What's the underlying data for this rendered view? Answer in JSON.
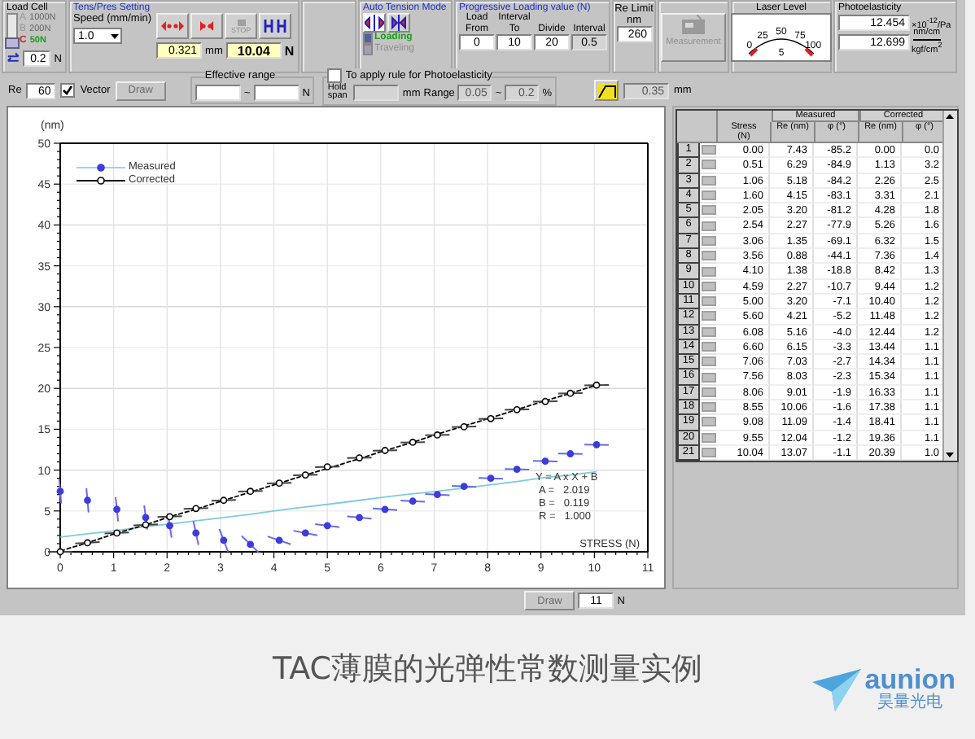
{
  "load_cell": {
    "title": "Load Cell",
    "ranges": [
      {
        "letter": "A",
        "label": "1000N",
        "selected": false
      },
      {
        "letter": "B",
        "label": "200N",
        "selected": false
      },
      {
        "letter": "C",
        "label": "50N",
        "selected": true
      }
    ],
    "value": "0.2",
    "unit": "N"
  },
  "tens_pres": {
    "title": "Tens/Pres Setting",
    "speed_label": "Speed (mm/min)",
    "speed": "1.0",
    "buttons": [
      {
        "kind": "tension",
        "disabled": false
      },
      {
        "kind": "compression",
        "disabled": false
      },
      {
        "kind": "stop",
        "label": "STOP",
        "disabled": true
      },
      {
        "kind": "hold",
        "disabled": false
      }
    ],
    "displacement": "0.321",
    "displacement_unit": "mm",
    "force": "10.04",
    "force_unit": "N"
  },
  "auto_tension": {
    "title": "Auto Tension Mode",
    "modes": [
      {
        "label": "Loading",
        "selected": true
      },
      {
        "label": "Traveling",
        "selected": false
      }
    ]
  },
  "progressive": {
    "title": "Progressive Loading value (N)",
    "fields": [
      {
        "label": "Load From",
        "value": "0",
        "disabled": false
      },
      {
        "label": "Interval To",
        "value": "10",
        "disabled": false
      },
      {
        "label": "Divide",
        "value": "20",
        "disabled": false
      },
      {
        "label": "Interval",
        "value": "0.5",
        "disabled": true
      }
    ]
  },
  "re_limit": {
    "label": "Re Limit",
    "unit": "nm",
    "value": "260"
  },
  "measurement_button": {
    "label": "Measurement",
    "disabled": true
  },
  "laser_level": {
    "title": "Laser Level",
    "ticks": [
      "0",
      "25",
      "50",
      "75",
      "100"
    ],
    "reading": "5"
  },
  "photoelasticity": {
    "title": "Photoelasticity",
    "values": [
      {
        "value": "12.454",
        "unit": "×10$^{-12}$/Pa"
      },
      {
        "value": "12.699",
        "unit_top": "nm/cm",
        "unit_bottom": "kgf/cm$^{2}$"
      }
    ]
  },
  "options": {
    "re_label": "Re",
    "re_value": "60",
    "vector": {
      "label": "Vector",
      "checked": true
    },
    "draw_button": {
      "label": "Draw",
      "disabled": true
    },
    "effective_range": {
      "title": "Effective range",
      "separator": "~",
      "unit": "N"
    },
    "photo_rule": {
      "label": "To apply rule for Photoelasticity",
      "checked": false
    },
    "hold_span": {
      "label": "Hold span",
      "unit": "mm"
    },
    "range": {
      "label": "Range",
      "from": "0.05",
      "separator": "~",
      "to": "0.2",
      "unit": "%"
    },
    "offset": {
      "value": "0.35",
      "unit": "mm"
    }
  },
  "chart": {
    "chart_data": {
      "type": "scatter",
      "ylabel": "(nm)",
      "xlabel": "STRESS (N)",
      "xlim": [
        0,
        11
      ],
      "ylim": [
        0,
        50
      ],
      "xticks": [
        {
          "value": 0,
          "label": "0"
        },
        {
          "value": 1,
          "label": "1"
        },
        {
          "value": 2,
          "label": "2"
        },
        {
          "value": 3,
          "label": "3"
        },
        {
          "value": 4,
          "label": "4"
        },
        {
          "value": 5,
          "label": "5"
        },
        {
          "value": 6,
          "label": "6"
        },
        {
          "value": 7,
          "label": "7"
        },
        {
          "value": 8,
          "label": "8"
        },
        {
          "value": 9,
          "label": "9"
        },
        {
          "value": 10,
          "label": "10"
        },
        {
          "value": 11,
          "label": "11"
        }
      ],
      "yticks": [
        {
          "value": 0,
          "label": "0"
        },
        {
          "value": 5,
          "label": "5"
        },
        {
          "value": 10,
          "label": "10"
        },
        {
          "value": 15,
          "label": "15"
        },
        {
          "value": 20,
          "label": "20"
        },
        {
          "value": 25,
          "label": "25"
        },
        {
          "value": 30,
          "label": "30"
        },
        {
          "value": 35,
          "label": "35"
        },
        {
          "value": 40,
          "label": "40"
        },
        {
          "value": 45,
          "label": "45"
        },
        {
          "value": 50,
          "label": "50"
        }
      ],
      "x": [
        0.0,
        0.51,
        1.06,
        1.6,
        2.05,
        2.54,
        3.06,
        3.56,
        4.1,
        4.59,
        5.0,
        5.6,
        6.08,
        6.6,
        7.06,
        7.56,
        8.06,
        8.55,
        9.08,
        9.55,
        10.04
      ],
      "series": [
        {
          "name": "Measured",
          "color": "#3c3cdc",
          "values": [
            7.4,
            6.3,
            5.2,
            4.2,
            3.2,
            2.3,
            1.4,
            0.9,
            1.4,
            2.3,
            3.2,
            4.2,
            5.2,
            6.2,
            7.0,
            8.0,
            9.0,
            10.1,
            11.1,
            12.0,
            13.1
          ]
        },
        {
          "name": "Corrected",
          "color": "#000000",
          "values": [
            0.0,
            1.1,
            2.3,
            3.3,
            4.3,
            5.3,
            6.3,
            7.4,
            8.4,
            9.4,
            10.4,
            11.5,
            12.4,
            13.4,
            14.3,
            15.3,
            16.3,
            17.4,
            18.4,
            19.4,
            20.4
          ]
        },
        {
          "type": "line",
          "color": "#7ccbdc",
          "line_style": "solid",
          "values": [
            1.8,
            2.2,
            2.6,
            3.1,
            3.4,
            3.8,
            4.2,
            4.6,
            5.1,
            5.5,
            5.8,
            6.3,
            6.7,
            7.1,
            7.4,
            7.8,
            8.2,
            8.6,
            9.1,
            9.4,
            9.8
          ]
        },
        {
          "type": "line",
          "color": "#000000",
          "line_style": "dashed",
          "values": [
            0.1,
            1.1,
            2.3,
            3.3,
            4.3,
            5.2,
            6.3,
            7.3,
            8.4,
            9.4,
            10.2,
            11.4,
            12.4,
            13.4,
            14.4,
            15.4,
            16.4,
            17.4,
            18.5,
            19.4,
            20.4
          ]
        }
      ],
      "legend": "upper left",
      "grid": true,
      "annotations": [
        "Y = A x X + B",
        "A =   2.019",
        "B =   0.119",
        "R =   1.000"
      ]
    }
  },
  "table": {
    "groups": [
      "Measured",
      "Corrected"
    ],
    "columns": [
      "Stress (N)",
      "Re (nm)",
      "φ (°)",
      "Re (nm)",
      "φ (°)"
    ],
    "rows": [
      {
        "index": "1",
        "cells": [
          "0.00",
          "7.43",
          "-85.2",
          "0.00",
          "0.0"
        ]
      },
      {
        "index": "2",
        "cells": [
          "0.51",
          "6.29",
          "-84.9",
          "1.13",
          "3.2"
        ]
      },
      {
        "index": "3",
        "cells": [
          "1.06",
          "5.18",
          "-84.2",
          "2.26",
          "2.5"
        ]
      },
      {
        "index": "4",
        "cells": [
          "1.60",
          "4.15",
          "-83.1",
          "3.31",
          "2.1"
        ]
      },
      {
        "index": "5",
        "cells": [
          "2.05",
          "3.20",
          "-81.2",
          "4.28",
          "1.8"
        ]
      },
      {
        "index": "6",
        "cells": [
          "2.54",
          "2.27",
          "-77.9",
          "5.26",
          "1.6"
        ]
      },
      {
        "index": "7",
        "cells": [
          "3.06",
          "1.35",
          "-69.1",
          "6.32",
          "1.5"
        ]
      },
      {
        "index": "8",
        "cells": [
          "3.56",
          "0.88",
          "-44.1",
          "7.36",
          "1.4"
        ]
      },
      {
        "index": "9",
        "cells": [
          "4.10",
          "1.38",
          "-18.8",
          "8.42",
          "1.3"
        ]
      },
      {
        "index": "10",
        "cells": [
          "4.59",
          "2.27",
          "-10.7",
          "9.44",
          "1.2"
        ]
      },
      {
        "index": "11",
        "cells": [
          "5.00",
          "3.20",
          "-7.1",
          "10.40",
          "1.2"
        ]
      },
      {
        "index": "12",
        "cells": [
          "5.60",
          "4.21",
          "-5.2",
          "11.48",
          "1.2"
        ]
      },
      {
        "index": "13",
        "cells": [
          "6.08",
          "5.16",
          "-4.0",
          "12.44",
          "1.2"
        ]
      },
      {
        "index": "14",
        "cells": [
          "6.60",
          "6.15",
          "-3.3",
          "13.44",
          "1.1"
        ]
      },
      {
        "index": "15",
        "cells": [
          "7.06",
          "7.03",
          "-2.7",
          "14.34",
          "1.1"
        ]
      },
      {
        "index": "16",
        "cells": [
          "7.56",
          "8.03",
          "-2.3",
          "15.34",
          "1.1"
        ]
      },
      {
        "index": "17",
        "cells": [
          "8.06",
          "9.01",
          "-1.9",
          "16.33",
          "1.1"
        ]
      },
      {
        "index": "18",
        "cells": [
          "8.55",
          "10.06",
          "-1.6",
          "17.38",
          "1.1"
        ]
      },
      {
        "index": "19",
        "cells": [
          "9.08",
          "11.09",
          "-1.4",
          "18.41",
          "1.1"
        ]
      },
      {
        "index": "20",
        "cells": [
          "9.55",
          "12.04",
          "-1.2",
          "19.36",
          "1.1"
        ]
      },
      {
        "index": "21",
        "cells": [
          "10.04",
          "13.07",
          "-1.1",
          "20.39",
          "1.0"
        ]
      }
    ]
  },
  "footer": {
    "draw_button": {
      "label": "Draw",
      "disabled": true
    },
    "value": "11",
    "unit": "N"
  },
  "caption": "TAC薄膜的光弹性常数测量实例",
  "logo": {
    "name": "aunion",
    "subtitle": "昊量光电"
  }
}
